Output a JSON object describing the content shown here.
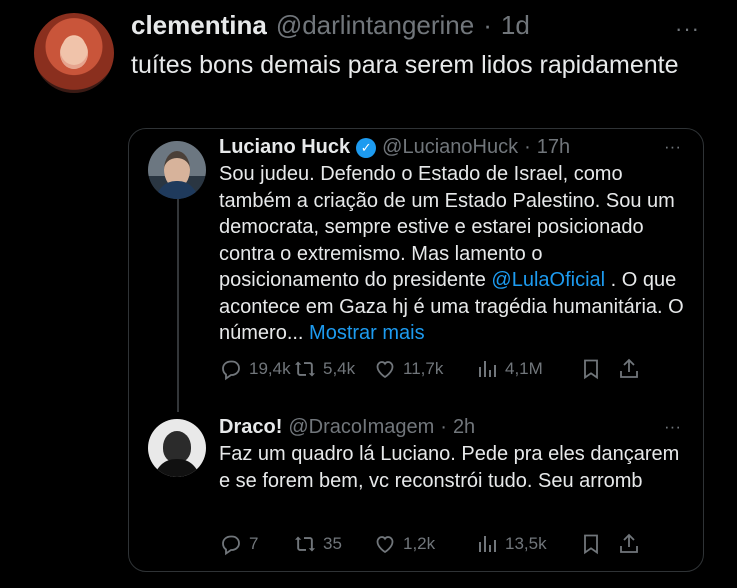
{
  "outer": {
    "name": "clementina",
    "handle": "@darlintangerine",
    "dot": "·",
    "time": "1d",
    "more": "···",
    "text": "tuítes bons demais para serem lidos rapidamente"
  },
  "quoted": {
    "name": "Luciano Huck",
    "verified": true,
    "handle": "@LucianoHuck",
    "dot": "·",
    "time": "17h",
    "more": "···",
    "text_before": "Sou judeu. Defendo o Estado de Israel, como também a criação de um Estado Palestino. Sou um democrata, sempre estive e estarei posicionado contra o extremismo. Mas lamento o posicionamento do presidente ",
    "mention": "@LulaOficial",
    "text_after": " . O que acontece em Gaza hj é uma tragédia humanitária. O número... ",
    "show_more": "Mostrar mais",
    "stats": {
      "replies": "19,4k",
      "retweets": "5,4k",
      "likes": "11,7k",
      "views": "4,1M"
    }
  },
  "reply": {
    "name": "Draco!",
    "handle": "@DracoImagem",
    "dot": "·",
    "time": "2h",
    "more": "···",
    "text": "Faz um quadro lá Luciano. Pede pra eles dançarem e se forem bem, vc reconstrói tudo. Seu arromb",
    "stats": {
      "replies": "7",
      "retweets": "35",
      "likes": "1,2k",
      "views": "13,5k"
    }
  },
  "icons": [
    "reply-icon",
    "retweet-icon",
    "like-icon",
    "views-icon",
    "bookmark-icon",
    "share-icon",
    "verified-icon",
    "more-icon"
  ],
  "colors": {
    "background": "#000000",
    "text": "#e7e9ea",
    "muted": "#71767b",
    "link": "#1d9bf0",
    "border": "#2f3336"
  }
}
